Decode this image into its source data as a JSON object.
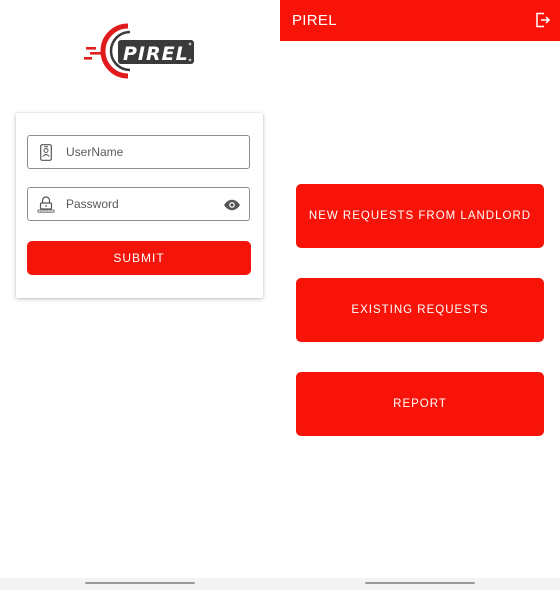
{
  "login": {
    "logo_text": "PIREL",
    "username_placeholder": "UserName",
    "password_placeholder": "Password",
    "submit_label": "SUBMIT"
  },
  "dashboard": {
    "title": "PIREL",
    "buttons": [
      {
        "label": "NEW REQUESTS FROM LANDLORD"
      },
      {
        "label": "EXISTING REQUESTS"
      },
      {
        "label": "REPORT"
      }
    ]
  },
  "colors": {
    "primary_red": "#f81309",
    "logo_dark": "#3a3a3a"
  },
  "icons": [
    "id-badge-icon",
    "lock-icon",
    "eye-icon",
    "logout-icon"
  ]
}
